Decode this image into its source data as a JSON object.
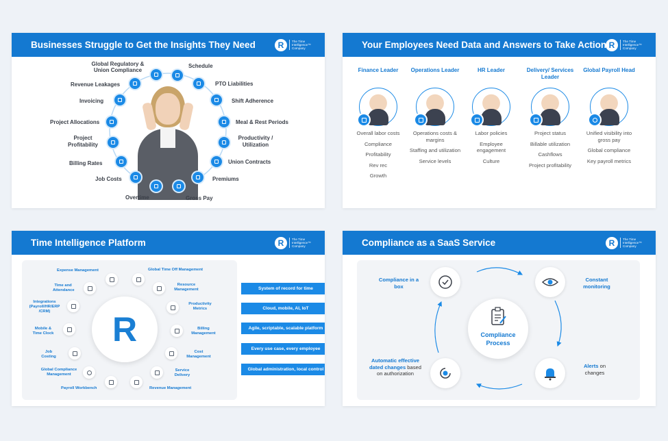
{
  "logo": {
    "letter": "R",
    "text": "The Time Intelligence™ Company"
  },
  "slide1": {
    "title": "Businesses Struggle to Get the Insights They Need",
    "labels": [
      "Global Regulatory & Union Compliance",
      "Schedule",
      "Revenue Leakages",
      "PTO Liabilities",
      "Invoicing",
      "Shift Adherence",
      "Project Allocations",
      "Meal & Rest Periods",
      "Project Profitability",
      "Productivity / Utilization",
      "Billing Rates",
      "Union Contracts",
      "Job Costs",
      "Premiums",
      "Overtime",
      "Gross Pay"
    ]
  },
  "slide2": {
    "title": "Your Employees Need Data and Answers to Take Action",
    "columns": [
      {
        "heading": "Finance Leader",
        "items": [
          "Overall labor costs",
          "Compliance",
          "Profitability",
          "Rev rec",
          "Growth"
        ]
      },
      {
        "heading": "Operations Leader",
        "items": [
          "Operations costs & margins",
          "Staffing and utilization",
          "Service levels"
        ]
      },
      {
        "heading": "HR Leader",
        "items": [
          "Labor policies",
          "Employee engagement",
          "Culture"
        ]
      },
      {
        "heading": "Delivery/ Services Leader",
        "items": [
          "Project status",
          "Billable utilization",
          "Cashflows",
          "Project profitability"
        ]
      },
      {
        "heading": "Global Payroll Head",
        "items": [
          "Unified visibility into gross pay",
          "Global compliance",
          "Key payroll metrics"
        ]
      }
    ]
  },
  "slide3": {
    "title": "Time Intelligence Platform",
    "center": "R",
    "modules": [
      "Expense Management",
      "Global Time Off Management",
      "Time and Attendance",
      "Resource Management",
      "Integrations (Payroll/HR/ERP /CRM)",
      "Productivity Metrics",
      "Mobile & Time Clock",
      "Billing Management",
      "Job Costing",
      "Cost Management",
      "Global Compliance Management",
      "Service Delivery",
      "Payroll Workbench",
      "Revenue Management"
    ],
    "buttons": [
      "System of record for time",
      "Cloud, mobile, AI, IoT",
      "Agile, scriptable, scalable platform",
      "Every use case, every employee",
      "Global administration, local control"
    ]
  },
  "slide4": {
    "title": "Compliance as a SaaS Service",
    "center": "Compliance Process",
    "tl": "Compliance in a box",
    "tr": "Constant monitoring",
    "br_b": "Alerts",
    "br_rest": " on changes",
    "bl_b": "Automatic effective dated changes",
    "bl_rest": " based on authorization"
  },
  "colors": {
    "accent": "#1479d1",
    "node": "#1b8ae6",
    "background": "#eef2f7"
  }
}
